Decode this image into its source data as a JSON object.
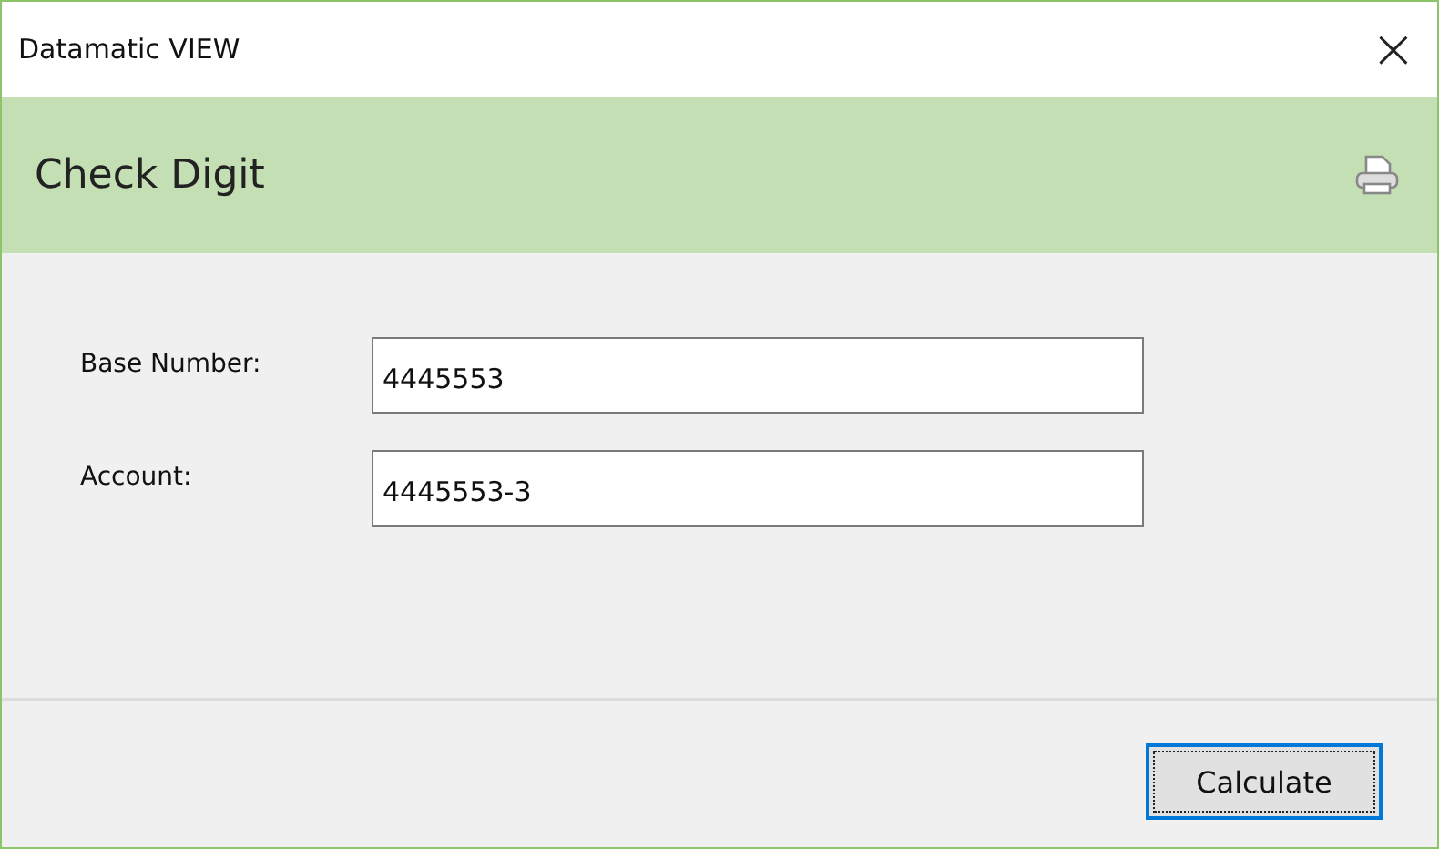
{
  "window": {
    "title": "Datamatic VIEW",
    "close": "×"
  },
  "header": {
    "title": "Check Digit"
  },
  "fields": [
    {
      "label": "Base Number:",
      "value": "4445553"
    },
    {
      "label": "Account:",
      "value": "4445553-3"
    }
  ],
  "buttons": [
    {
      "label": "Calculate",
      "focused": true
    }
  ]
}
